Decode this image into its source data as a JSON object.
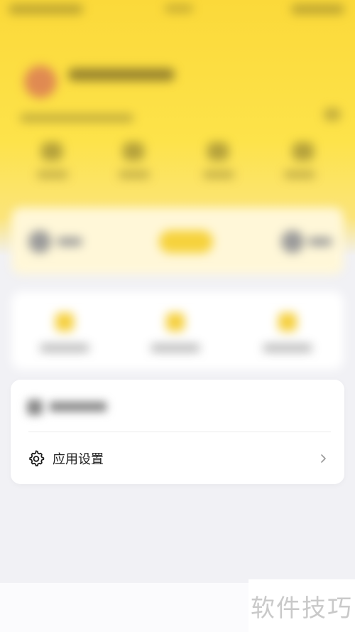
{
  "settings": {
    "app_settings_label": "应用设置",
    "app_settings_icon": "gear-icon",
    "chevron_icon": "chevron-right-icon"
  },
  "watermark": {
    "text": "软件技巧"
  },
  "colors": {
    "header_yellow": "#fde34a",
    "page_background": "#f1f1f5",
    "card_background": "#ffffff"
  }
}
